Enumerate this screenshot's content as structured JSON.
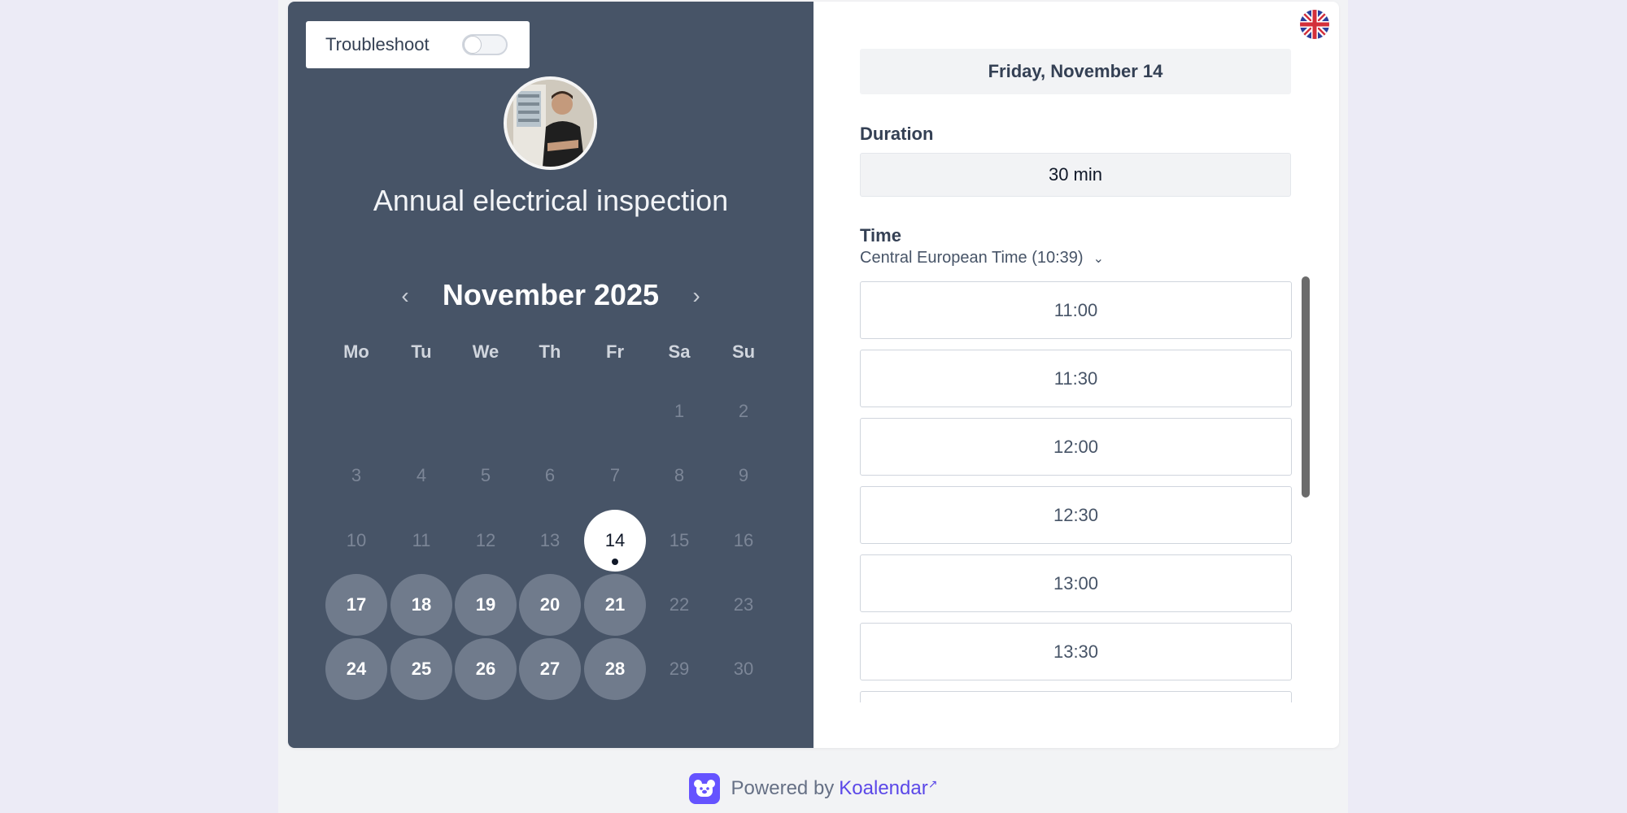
{
  "troubleshoot": {
    "label": "Troubleshoot",
    "enabled": false
  },
  "event": {
    "title": "Annual electrical inspection",
    "avatar_icon": "host-avatar-photo"
  },
  "calendar": {
    "month_label": "November 2025",
    "prev_icon": "chevron-left-icon",
    "next_icon": "chevron-right-icon",
    "weekdays": [
      "Mo",
      "Tu",
      "We",
      "Th",
      "Fr",
      "Sa",
      "Su"
    ],
    "weeks": [
      [
        {
          "d": ""
        },
        {
          "d": ""
        },
        {
          "d": ""
        },
        {
          "d": ""
        },
        {
          "d": ""
        },
        {
          "d": "1",
          "s": "inactive"
        },
        {
          "d": "2",
          "s": "inactive"
        }
      ],
      [
        {
          "d": "3",
          "s": "inactive"
        },
        {
          "d": "4",
          "s": "inactive"
        },
        {
          "d": "5",
          "s": "inactive"
        },
        {
          "d": "6",
          "s": "inactive"
        },
        {
          "d": "7",
          "s": "inactive"
        },
        {
          "d": "8",
          "s": "inactive"
        },
        {
          "d": "9",
          "s": "inactive"
        }
      ],
      [
        {
          "d": "10",
          "s": "inactive"
        },
        {
          "d": "11",
          "s": "inactive"
        },
        {
          "d": "12",
          "s": "inactive"
        },
        {
          "d": "13",
          "s": "inactive"
        },
        {
          "d": "14",
          "s": "selected"
        },
        {
          "d": "15",
          "s": "inactive"
        },
        {
          "d": "16",
          "s": "inactive"
        }
      ],
      [
        {
          "d": "17",
          "s": "available"
        },
        {
          "d": "18",
          "s": "available"
        },
        {
          "d": "19",
          "s": "available"
        },
        {
          "d": "20",
          "s": "available"
        },
        {
          "d": "21",
          "s": "available"
        },
        {
          "d": "22",
          "s": "inactive"
        },
        {
          "d": "23",
          "s": "inactive"
        }
      ],
      [
        {
          "d": "24",
          "s": "available"
        },
        {
          "d": "25",
          "s": "available"
        },
        {
          "d": "26",
          "s": "available"
        },
        {
          "d": "27",
          "s": "available"
        },
        {
          "d": "28",
          "s": "available"
        },
        {
          "d": "29",
          "s": "inactive"
        },
        {
          "d": "30",
          "s": "inactive"
        }
      ]
    ]
  },
  "language": {
    "icon": "uk-flag-icon"
  },
  "booking": {
    "selected_date": "Friday, November 14",
    "duration_label": "Duration",
    "duration_value": "30 min",
    "time_label": "Time",
    "timezone": "Central European Time (10:39)",
    "slots": [
      "11:00",
      "11:30",
      "12:00",
      "12:30",
      "13:00",
      "13:30",
      ""
    ]
  },
  "footer": {
    "powered_by": "Powered by",
    "brand": "Koalendar",
    "logo_icon": "koalendar-logo-icon"
  },
  "colors": {
    "panel": "#475467",
    "accent": "#6553ff",
    "available_day": "#707b8c"
  }
}
